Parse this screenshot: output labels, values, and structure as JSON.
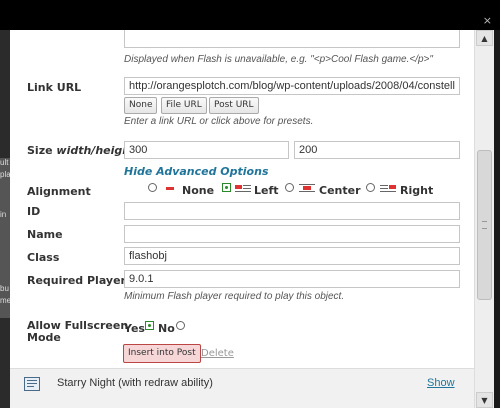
{
  "background_fragments": [
    "ult",
    "pla",
    "in",
    "bu",
    "me"
  ],
  "dialog": {
    "close_glyph": "×"
  },
  "form": {
    "alt_content": {
      "help": "Displayed when Flash is unavailable, e.g. \"<p>Cool Flash game.</p>\""
    },
    "link_url": {
      "label": "Link URL",
      "value": "http://orangesplotch.com/blog/wp-content/uploads/2008/04/constell",
      "buttons": [
        "None",
        "File URL",
        "Post URL"
      ],
      "help": "Enter a link URL or click above for presets."
    },
    "size": {
      "label_prefix": "Size",
      "label_em": "width/height",
      "width": "300",
      "height": "200"
    },
    "advanced_toggle": "Hide Advanced Options",
    "alignment": {
      "label": "Alignment",
      "options": [
        "None",
        "Left",
        "Center",
        "Right"
      ],
      "selected": "Left"
    },
    "id": {
      "label": "ID",
      "value": ""
    },
    "name": {
      "label": "Name",
      "value": ""
    },
    "class": {
      "label": "Class",
      "value": "flashobj"
    },
    "required_player": {
      "label": "Required Player",
      "value": "9.0.1",
      "help": "Minimum Flash player required to play this object."
    },
    "fullscreen": {
      "label_line1": "Allow Fullscreen",
      "label_line2": "Mode",
      "yes": "Yes",
      "no": "No",
      "selected": "Yes"
    },
    "insert_label": "Insert into Post",
    "delete_label": "Delete"
  },
  "media_item": {
    "title": "Starry Night (with redraw ability)",
    "show_label": "Show"
  },
  "colors": {
    "link": "#21759b",
    "insert_bg": "#f6d6d6",
    "radio_selected": "#2a8a2a"
  }
}
